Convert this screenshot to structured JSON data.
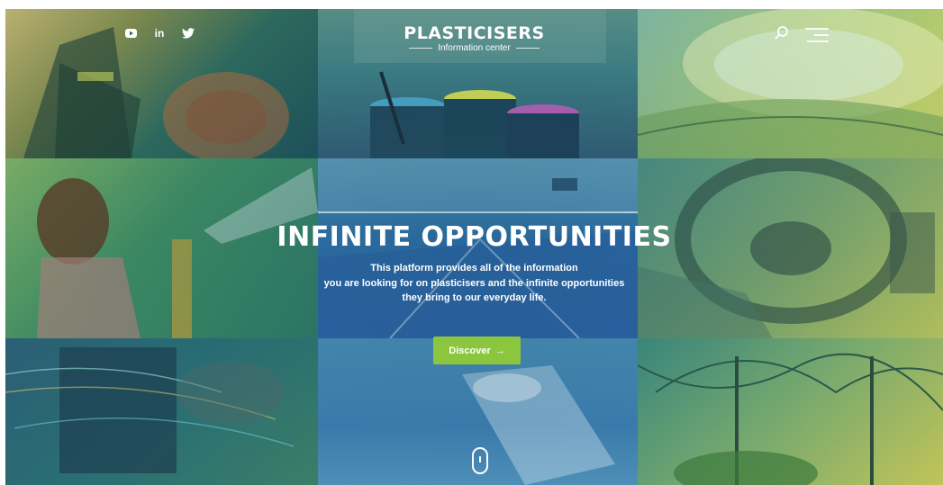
{
  "header": {
    "social_icons": [
      "youtube-icon",
      "linkedin-icon",
      "twitter-icon"
    ],
    "linkedin_text": "in",
    "logo_title": "PLASTICISERS",
    "logo_subtitle": "Information center",
    "search_icon": "search-icon",
    "menu_icon": "hamburger-menu-icon"
  },
  "hero": {
    "title": "INFINITE OPPORTUNITIES",
    "text_lines": [
      "This platform provides all of the information",
      "you are looking for on plasticisers and the infinite opportunities",
      "they bring to our everyday life."
    ],
    "cta_label": "Discover",
    "cta_icon": "→",
    "scroll_icon": "mouse-scroll-icon"
  },
  "colors": {
    "cta_background": "#8cc63f",
    "text": "#ffffff"
  }
}
